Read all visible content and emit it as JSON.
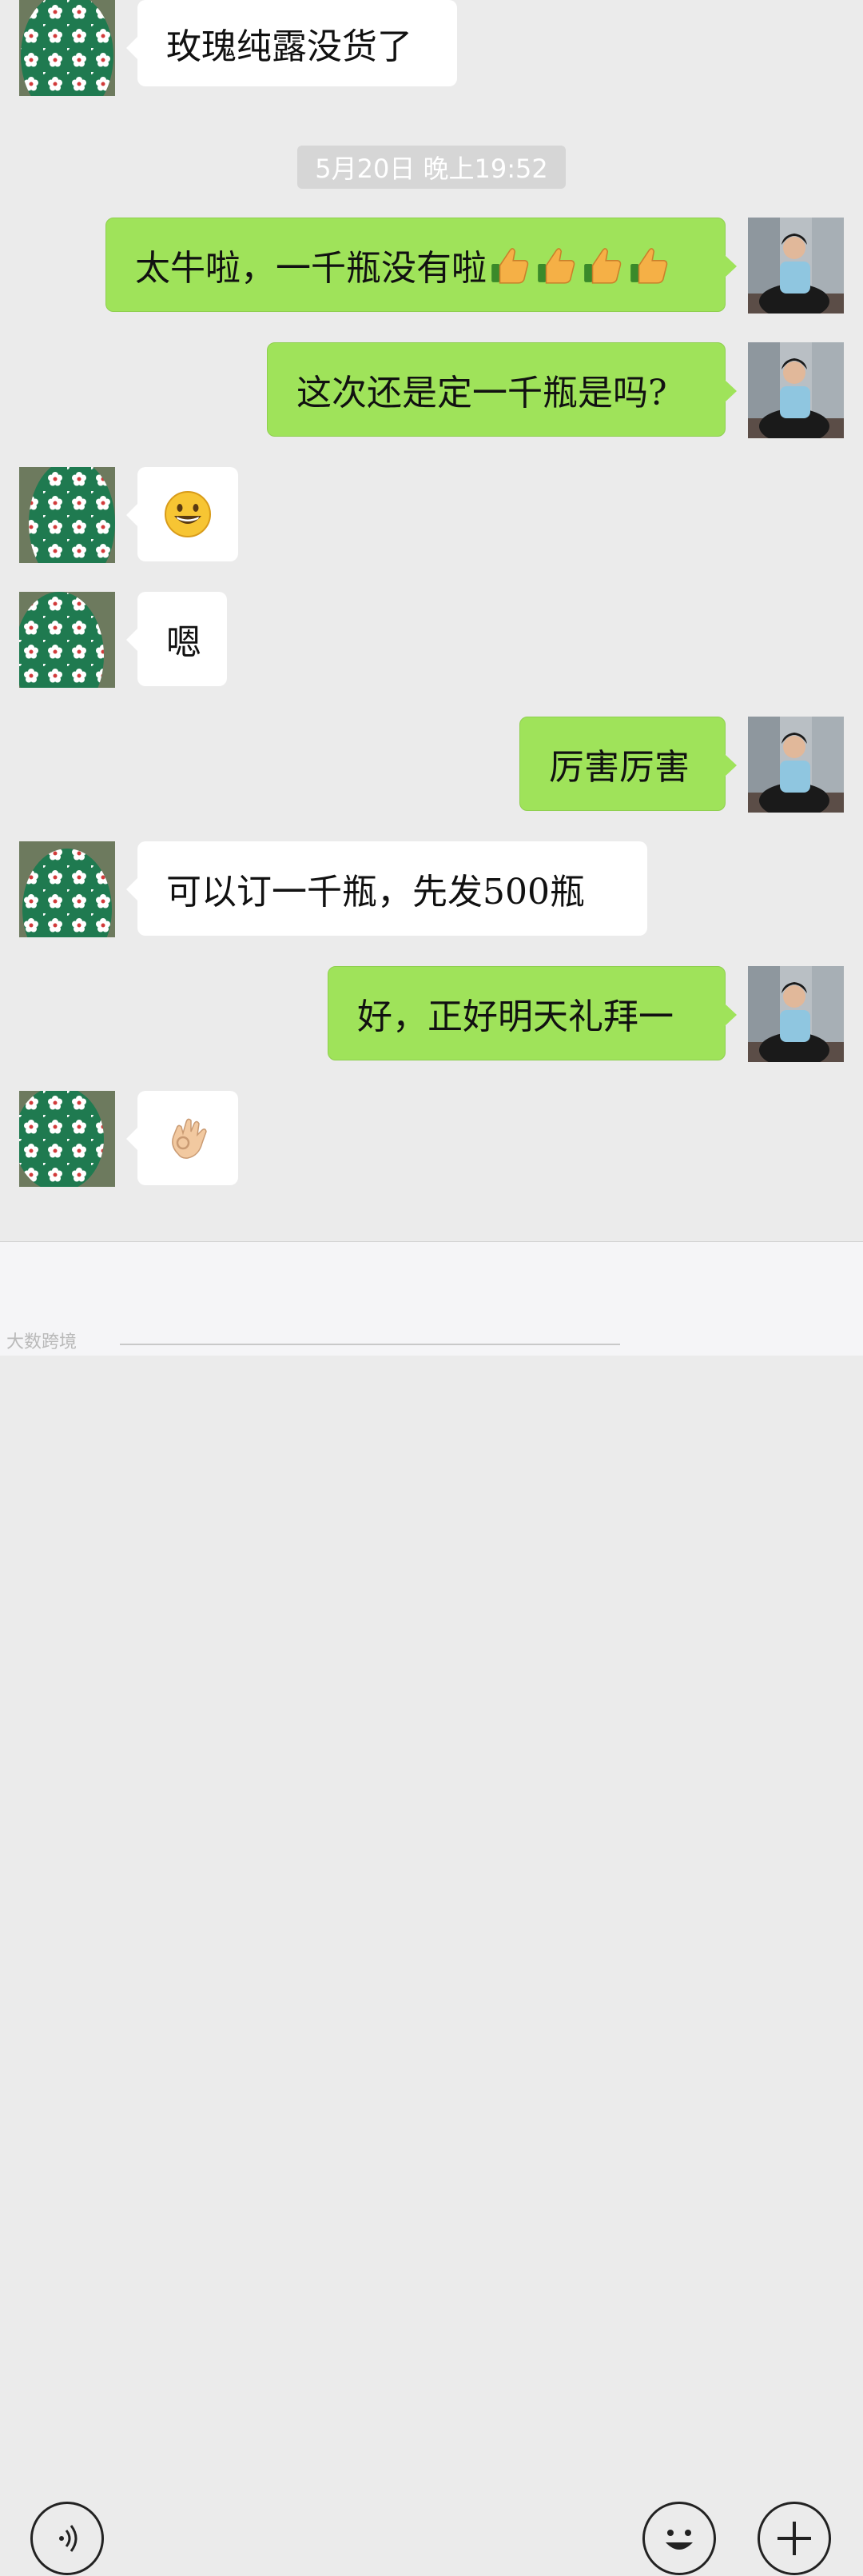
{
  "timestamp": "5月20日 晚上19:52",
  "messages": [
    {
      "side": "in",
      "text": "玫瑰纯露没货了"
    },
    {
      "side": "out",
      "text": "太牛啦，一千瓶没有啦"
    },
    {
      "side": "out",
      "text": "这次还是定一千瓶是吗?"
    },
    {
      "side": "in",
      "emoji": "grinning-face"
    },
    {
      "side": "in",
      "text": "嗯"
    },
    {
      "side": "out",
      "text": "厉害厉害"
    },
    {
      "side": "in",
      "text": "可以订一千瓶，先发500瓶"
    },
    {
      "side": "out",
      "text": "好，正好明天礼拜一"
    },
    {
      "side": "in",
      "emoji": "ok-hand"
    }
  ],
  "thumbs_up_count": 4,
  "bottom_bar": {
    "left_icon": "voice-icon",
    "emoji_icon": "smiley-icon",
    "plus_icon": "plus-icon"
  },
  "watermark": "大数跨境",
  "colors": {
    "background": "#ebebeb",
    "outgoing_bubble": "#9fe35a",
    "incoming_bubble": "#ffffff",
    "avatar_green": "#1f7a50"
  }
}
